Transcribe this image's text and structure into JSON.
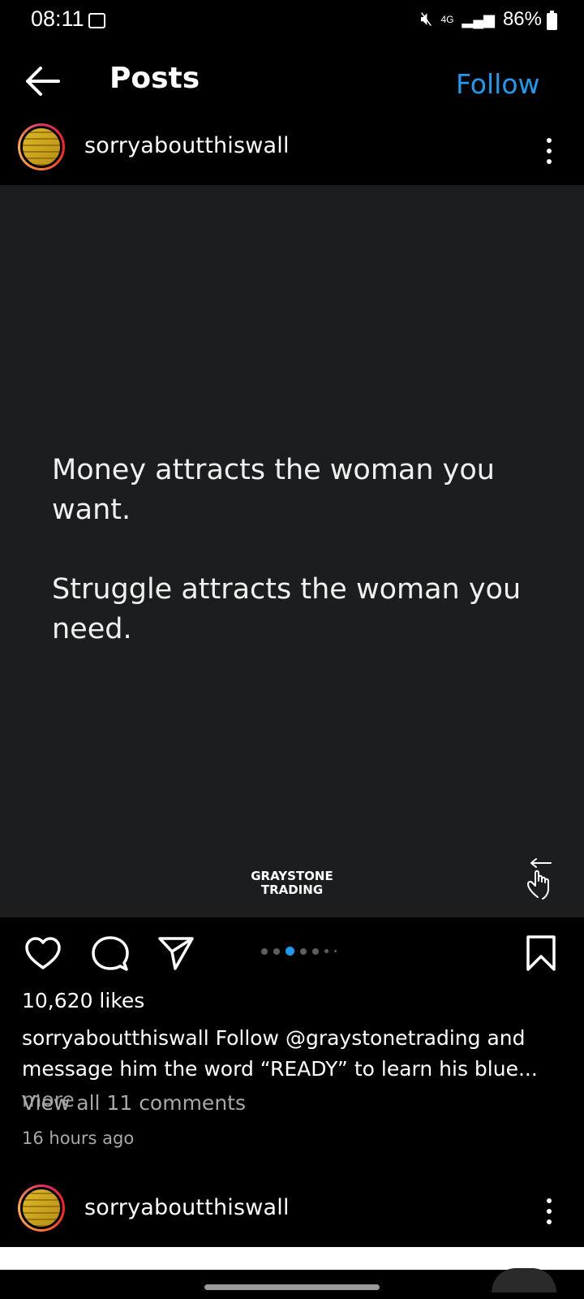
{
  "status_bar": {
    "time": "08:11",
    "signal": "4G",
    "battery": "86%"
  },
  "header": {
    "title": "Posts",
    "follow": "Follow"
  },
  "post": {
    "username": "sorryaboutthiswall",
    "quote_lines": [
      "Money attracts the woman you want.",
      "Struggle attracts the woman you need."
    ],
    "brand_line1": "GRAYSTONE",
    "brand_line2": "TRADING",
    "carousel": {
      "count": 7,
      "active_index": 2
    },
    "likes": "10,620 likes",
    "caption_user": "sorryaboutthiswall",
    "caption_text": " Follow @graystonetrading and message him the word “READY” to learn his blue...",
    "caption_more": " more",
    "view_comments": "View all 11 comments",
    "timestamp": "16 hours ago"
  },
  "next_post": {
    "username": "sorryaboutthiswall"
  },
  "colors": {
    "accent": "#1d9bf0",
    "image_bg": "#1c1d1e"
  }
}
